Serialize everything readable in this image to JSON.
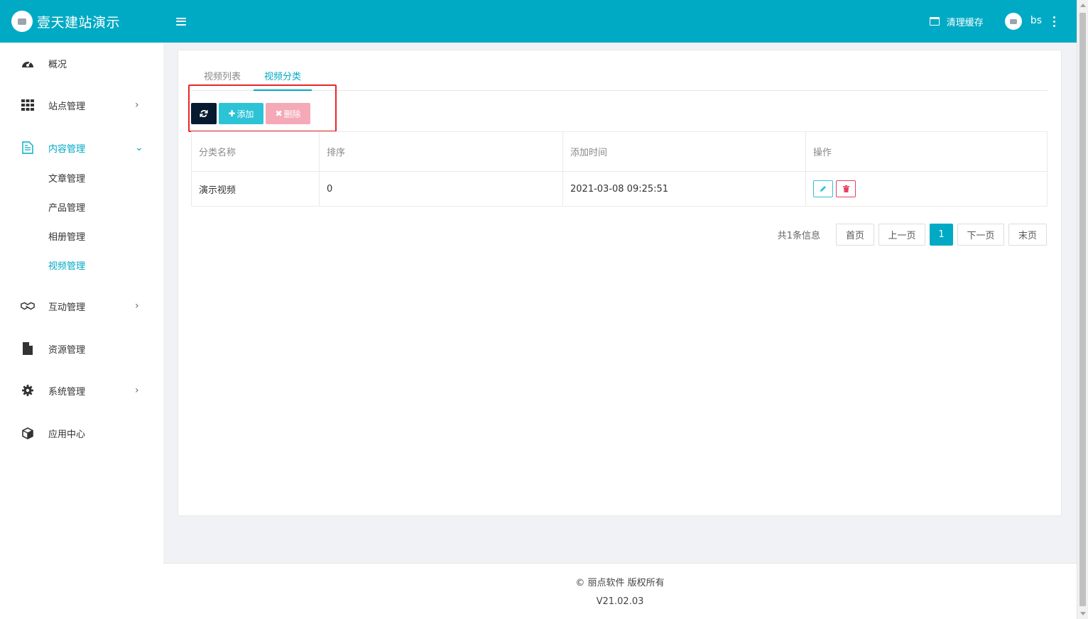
{
  "app": {
    "title": "壹天建站演示"
  },
  "header": {
    "clear_cache": "清理缓存",
    "username": "bs"
  },
  "sidebar": {
    "items": [
      {
        "label": "概况",
        "icon": "dashboard-icon"
      },
      {
        "label": "站点管理",
        "icon": "grid-icon",
        "chevron": "›"
      },
      {
        "label": "内容管理",
        "icon": "document-icon",
        "chevron": "⌄",
        "active": true
      },
      {
        "label": "互动管理",
        "icon": "handshake-icon",
        "chevron": "›"
      },
      {
        "label": "资源管理",
        "icon": "file-icon"
      },
      {
        "label": "系统管理",
        "icon": "gear-icon",
        "chevron": "›"
      },
      {
        "label": "应用中心",
        "icon": "cube-icon"
      }
    ],
    "content_sub": [
      {
        "label": "文章管理"
      },
      {
        "label": "产品管理"
      },
      {
        "label": "相册管理"
      },
      {
        "label": "视频管理",
        "active": true
      }
    ]
  },
  "tabs": [
    {
      "label": "视频列表"
    },
    {
      "label": "视频分类",
      "active": true
    }
  ],
  "toolbar": {
    "add_label": "添加",
    "delete_label": "删除"
  },
  "table": {
    "columns": [
      "分类名称",
      "排序",
      "添加时间",
      "操作"
    ],
    "rows": [
      {
        "name": "演示视频",
        "sort": "0",
        "time": "2021-03-08 09:25:51"
      }
    ]
  },
  "pager": {
    "info": "共1条信息",
    "first": "首页",
    "prev": "上一页",
    "current": "1",
    "next": "下一页",
    "last": "末页"
  },
  "footer": {
    "copyright": "© 丽点软件 版权所有",
    "version": "V21.02.03"
  },
  "colors": {
    "primary": "#00aac4",
    "highlight_border": "#e8262a",
    "add_button": "#2dc3d6",
    "delete_button": "#f5a9b7",
    "refresh_button": "#071a2f"
  }
}
